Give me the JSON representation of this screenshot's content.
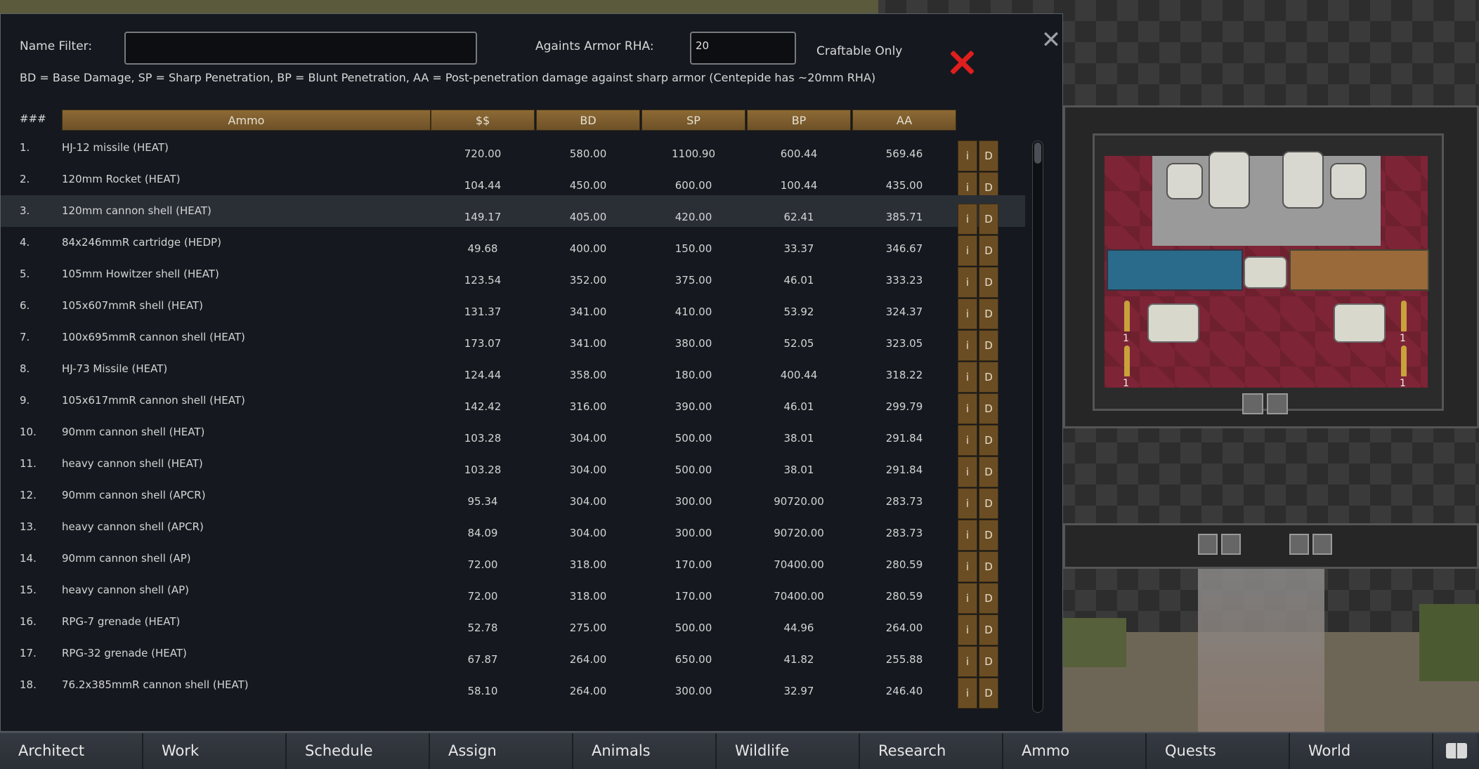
{
  "dialog": {
    "name_filter_label": "Name Filter:",
    "name_filter_value": "",
    "armor_label": "Againts Armor RHA:",
    "armor_value": "20",
    "craftable_label": "Craftable Only",
    "legend": "BD = Base Damage, SP = Sharp Penetration, BP = Blunt Penetration, AA = Post-penetration damage against sharp armor (Centepide has ~20mm RHA)",
    "close_glyph": "✕",
    "table": {
      "index_header": "###",
      "columns": [
        "Ammo",
        "$$",
        "BD",
        "SP",
        "BP",
        "AA"
      ],
      "info_button": "i",
      "detail_button": "D",
      "highlighted_row": 3,
      "rows": [
        {
          "idx": "1.",
          "name": "HJ-12 missile (HEAT)",
          "cost": "720.00",
          "bd": "580.00",
          "sp": "1100.90",
          "bp": "600.44",
          "aa": "569.46"
        },
        {
          "idx": "2.",
          "name": "120mm Rocket (HEAT)",
          "cost": "104.44",
          "bd": "450.00",
          "sp": "600.00",
          "bp": "100.44",
          "aa": "435.00"
        },
        {
          "idx": "3.",
          "name": "120mm cannon shell (HEAT)",
          "cost": "149.17",
          "bd": "405.00",
          "sp": "420.00",
          "bp": "62.41",
          "aa": "385.71"
        },
        {
          "idx": "4.",
          "name": "84x246mmR cartridge (HEDP)",
          "cost": "49.68",
          "bd": "400.00",
          "sp": "150.00",
          "bp": "33.37",
          "aa": "346.67"
        },
        {
          "idx": "5.",
          "name": "105mm Howitzer shell (HEAT)",
          "cost": "123.54",
          "bd": "352.00",
          "sp": "375.00",
          "bp": "46.01",
          "aa": "333.23"
        },
        {
          "idx": "6.",
          "name": "105x607mmR shell (HEAT)",
          "cost": "131.37",
          "bd": "341.00",
          "sp": "410.00",
          "bp": "53.92",
          "aa": "324.37"
        },
        {
          "idx": "7.",
          "name": "100x695mmR cannon shell (HEAT)",
          "cost": "173.07",
          "bd": "341.00",
          "sp": "380.00",
          "bp": "52.05",
          "aa": "323.05"
        },
        {
          "idx": "8.",
          "name": "HJ-73 Missile (HEAT)",
          "cost": "124.44",
          "bd": "358.00",
          "sp": "180.00",
          "bp": "400.44",
          "aa": "318.22"
        },
        {
          "idx": "9.",
          "name": "105x617mmR cannon shell (HEAT)",
          "cost": "142.42",
          "bd": "316.00",
          "sp": "390.00",
          "bp": "46.01",
          "aa": "299.79"
        },
        {
          "idx": "10.",
          "name": "90mm cannon shell (HEAT)",
          "cost": "103.28",
          "bd": "304.00",
          "sp": "500.00",
          "bp": "38.01",
          "aa": "291.84"
        },
        {
          "idx": "11.",
          "name": "heavy cannon shell (HEAT)",
          "cost": "103.28",
          "bd": "304.00",
          "sp": "500.00",
          "bp": "38.01",
          "aa": "291.84"
        },
        {
          "idx": "12.",
          "name": "90mm cannon shell (APCR)",
          "cost": "95.34",
          "bd": "304.00",
          "sp": "300.00",
          "bp": "90720.00",
          "aa": "283.73"
        },
        {
          "idx": "13.",
          "name": "heavy cannon shell (APCR)",
          "cost": "84.09",
          "bd": "304.00",
          "sp": "300.00",
          "bp": "90720.00",
          "aa": "283.73"
        },
        {
          "idx": "14.",
          "name": "90mm cannon shell (AP)",
          "cost": "72.00",
          "bd": "318.00",
          "sp": "170.00",
          "bp": "70400.00",
          "aa": "280.59"
        },
        {
          "idx": "15.",
          "name": "heavy cannon shell (AP)",
          "cost": "72.00",
          "bd": "318.00",
          "sp": "170.00",
          "bp": "70400.00",
          "aa": "280.59"
        },
        {
          "idx": "16.",
          "name": "RPG-7 grenade (HEAT)",
          "cost": "52.78",
          "bd": "275.00",
          "sp": "500.00",
          "bp": "44.96",
          "aa": "264.00"
        },
        {
          "idx": "17.",
          "name": "RPG-32 grenade (HEAT)",
          "cost": "67.87",
          "bd": "264.00",
          "sp": "650.00",
          "bp": "41.82",
          "aa": "255.88"
        },
        {
          "idx": "18.",
          "name": "76.2x385mmR cannon shell (HEAT)",
          "cost": "58.10",
          "bd": "264.00",
          "sp": "300.00",
          "bp": "32.97",
          "aa": "246.40"
        }
      ]
    }
  },
  "world": {
    "shell_counts": [
      "1",
      "1",
      "1",
      "1"
    ]
  },
  "bottombar": {
    "tabs": [
      "Architect",
      "Work",
      "Schedule",
      "Assign",
      "Animals",
      "Wildlife",
      "Research",
      "Ammo",
      "Quests",
      "World"
    ],
    "book_icon": "book-icon"
  },
  "colors": {
    "accent_brown": "#8d6a35",
    "dialog_bg": "#15191f",
    "craftable_off_red": "#e01e1e",
    "floor_red": "#7d2436"
  }
}
